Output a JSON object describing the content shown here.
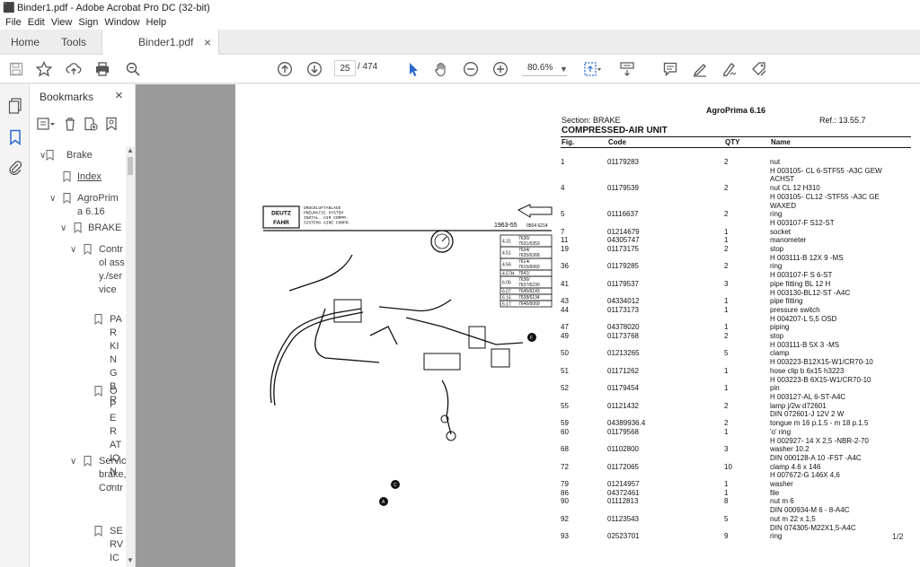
{
  "window": {
    "title": "Binder1.pdf - Adobe Acrobat Pro DC (32-bit)"
  },
  "menu": [
    "File",
    "Edit",
    "View",
    "Sign",
    "Window",
    "Help"
  ],
  "tabs": {
    "home": "Home",
    "tools": "Tools",
    "doc": "Binder1.pdf",
    "doc_close": "×"
  },
  "nav": {
    "current_page": "25",
    "total_pages": "/ 474",
    "zoom": "80.6%"
  },
  "bookmarks": {
    "title": "Bookmarks",
    "close": "×",
    "items": [
      {
        "label": "Brake",
        "level": 0,
        "expanded": true
      },
      {
        "label": "Index",
        "level": 1,
        "expanded": false,
        "link": true
      },
      {
        "label": "AgroPrima 6.16",
        "level": 1,
        "expanded": true
      },
      {
        "label": "BRAKE",
        "level": 2,
        "expanded": true
      },
      {
        "label": "Control assy./service",
        "level": 3,
        "expanded": true
      },
      {
        "label": "PARKING BR",
        "level": 4,
        "expanded": false
      },
      {
        "label": "OPERATION -",
        "level": 4,
        "expanded": false
      },
      {
        "label": "Service brake, Contr",
        "level": 3,
        "expanded": true
      },
      {
        "label": "SERVICE",
        "level": 4,
        "expanded": false
      }
    ]
  },
  "doc": {
    "model": "AgroPrima 6.16",
    "section": "Section: BRAKE",
    "ref": "Ref.: 13.55.7",
    "title": "COMPRESSED-AIR UNIT",
    "headers": [
      "Fig.",
      "Code",
      "QTY",
      "Name"
    ],
    "rows": [
      [
        "1",
        "01179283",
        "2",
        "nut"
      ],
      [
        "",
        "",
        "",
        "H 003105- CL 6-STF55 -A3C GEW"
      ],
      [
        "",
        "",
        "",
        "ACHST"
      ],
      [
        "4",
        "01179539",
        "2",
        "nut CL 12 H310"
      ],
      [
        "",
        "",
        "",
        "H 003105- CL12 -STF55 -A3C GE"
      ],
      [
        "",
        "",
        "",
        "WAXED"
      ],
      [
        "5",
        "01116637",
        "2",
        "ring"
      ],
      [
        "",
        "",
        "",
        "H 003107-F S12-ST"
      ],
      [
        "7",
        "01214679",
        "1",
        "socket"
      ],
      [
        "11",
        "04305747",
        "1",
        "manometer"
      ],
      [
        "19",
        "01173175",
        "2",
        "stop"
      ],
      [
        "",
        "",
        "",
        "H 003111-B 12X 9 -MS"
      ],
      [
        "36",
        "01179285",
        "2",
        "ring"
      ],
      [
        "",
        "",
        "",
        "H 003107-F S 6-ST"
      ],
      [
        "41",
        "01179537",
        "3",
        "pipe fitting BL 12 H"
      ],
      [
        "",
        "",
        "",
        "H 003130-BL12-ST -A4C"
      ],
      [
        "43",
        "04334012",
        "1",
        "pipe fitting"
      ],
      [
        "44",
        "01173173",
        "1",
        "pressure switch"
      ],
      [
        "",
        "",
        "",
        "H 004207-L 5,5 OSD"
      ],
      [
        "47",
        "04378020",
        "1",
        "piping"
      ],
      [
        "49",
        "01173768",
        "2",
        "stop"
      ],
      [
        "",
        "",
        "",
        "H 003111-B 5X 3 -MS"
      ],
      [
        "50",
        "01213265",
        "5",
        "clamp"
      ],
      [
        "",
        "",
        "",
        "H 003223-B12X15-W1/CR70-10"
      ],
      [
        "51",
        "01171262",
        "1",
        "hose clip b 6x15 h3223"
      ],
      [
        "",
        "",
        "",
        "H 003223-B 6X15-W1/CR70-10"
      ],
      [
        "52",
        "01179454",
        "1",
        "pin"
      ],
      [
        "",
        "",
        "",
        "H 003127-AL 6-ST-A4C"
      ],
      [
        "55",
        "01121432",
        "2",
        "lamp j/2w d72601"
      ],
      [
        "",
        "",
        "",
        "DIN 072601-J 12V 2 W"
      ],
      [
        "59",
        "04389936.4",
        "2",
        "tongue m 16 p.1.5 - m 18 p.1.5"
      ],
      [
        "60",
        "01179568",
        "1",
        "'o' ring"
      ],
      [
        "",
        "",
        "",
        "H 002927- 14 X 2,5 -NBR-2-70"
      ],
      [
        "68",
        "01102800",
        "3",
        "washer 10.2"
      ],
      [
        "",
        "",
        "",
        "DIN 000128-A 10 -FST -A4C"
      ],
      [
        "72",
        "01172065",
        "10",
        "clamp 4.6 x 146"
      ],
      [
        "",
        "",
        "",
        "H 007672-G 146X 4,6"
      ],
      [
        "79",
        "01214957",
        "1",
        "washer"
      ],
      [
        "86",
        "04372461",
        "1",
        "file"
      ],
      [
        "90",
        "01112813",
        "8",
        "nut m 6"
      ],
      [
        "",
        "",
        "",
        "DIN 000934-M 6 - 8-A4C"
      ],
      [
        "92",
        "01123543",
        "5",
        "nut m 22 x 1,5"
      ],
      [
        "",
        "",
        "",
        "DIN 074305-M22X1,5-A4C"
      ],
      [
        "93",
        "02523701",
        "9",
        "ring"
      ]
    ],
    "page_indicator": "1/2",
    "diagram": {
      "logo": "DEUTZ FAHR",
      "caption_lines": [
        "DRUCKLUFTANLAGE",
        "PNEUMATIC SYSTEM",
        "INSTAL. AIR COMPR.",
        "SISTEMA AIRE COMPR."
      ],
      "drawing_code": "1963-55",
      "drawing_sub": "0504 6214",
      "side_table": [
        [
          "4.31",
          "7630/\n7631/6353"
        ],
        [
          "4.51",
          "7634/\n7635/6368"
        ],
        [
          "4.56",
          "7614/\n7615/6060"
        ],
        [
          "4.57H",
          "7641/"
        ],
        [
          "6.06",
          "7636/\n7637/6230"
        ],
        [
          "6.07",
          "7645/6143"
        ],
        [
          "6.16",
          "7638/6134"
        ],
        [
          "6.17",
          "7646/6069"
        ]
      ]
    }
  }
}
